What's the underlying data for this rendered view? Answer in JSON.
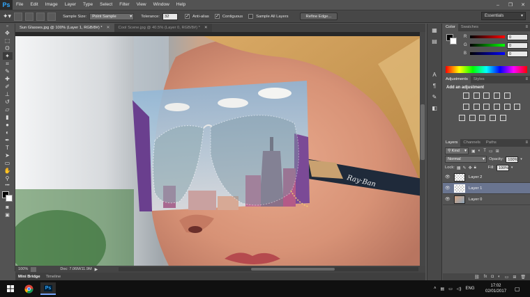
{
  "app": {
    "logo": "Ps"
  },
  "menu": [
    "File",
    "Edit",
    "Image",
    "Layer",
    "Type",
    "Select",
    "Filter",
    "View",
    "Window",
    "Help"
  ],
  "options": {
    "sample_size_label": "Sample Size:",
    "sample_size_value": "Point Sample",
    "tolerance_label": "Tolerance:",
    "tolerance_value": "32",
    "anti_alias_label": "Anti-alias",
    "anti_alias_checked": true,
    "contiguous_label": "Contiguous",
    "contiguous_checked": true,
    "sample_all_layers_label": "Sample All Layers",
    "sample_all_layers_checked": false,
    "refine_edge_label": "Refine Edge...",
    "workspace": "Essentials"
  },
  "tabs": [
    {
      "label": "Sun Glasses.jpg @ 100% (Layer 1, RGB/8#) *",
      "active": true
    },
    {
      "label": "Cool Scene.jpg @ 40.5% (Layer 0, RGB/8#) *",
      "active": false
    }
  ],
  "status": {
    "zoom": "100%",
    "doc": "Doc: 7.06M/11.9M"
  },
  "bottom_tabs": [
    "Mini Bridge",
    "Timeline"
  ],
  "color_panel": {
    "tabs": [
      "Color",
      "Swatches"
    ],
    "sliders": [
      {
        "label": "R",
        "value": "0"
      },
      {
        "label": "G",
        "value": "0"
      },
      {
        "label": "B",
        "value": "0"
      }
    ]
  },
  "adjustments_panel": {
    "tabs": [
      "Adjustments",
      "Styles"
    ],
    "heading": "Add an adjustment"
  },
  "layers_panel": {
    "tabs": [
      "Layers",
      "Channels",
      "Paths"
    ],
    "kind_label": "Kind",
    "blend_mode": "Normal",
    "opacity_label": "Opacity:",
    "opacity_value": "100%",
    "lock_label": "Lock:",
    "fill_label": "Fill:",
    "fill_value": "100%",
    "layers": [
      {
        "name": "Layer 2",
        "selected": false
      },
      {
        "name": "Layer 1",
        "selected": true
      },
      {
        "name": "Layer 0",
        "selected": false
      }
    ]
  },
  "taskbar": {
    "language": "ENG",
    "time": "17:02",
    "date": "02/01/2017"
  },
  "colors": {
    "accent_blue": "#31a8ff",
    "selected_layer": "#6a7590"
  }
}
